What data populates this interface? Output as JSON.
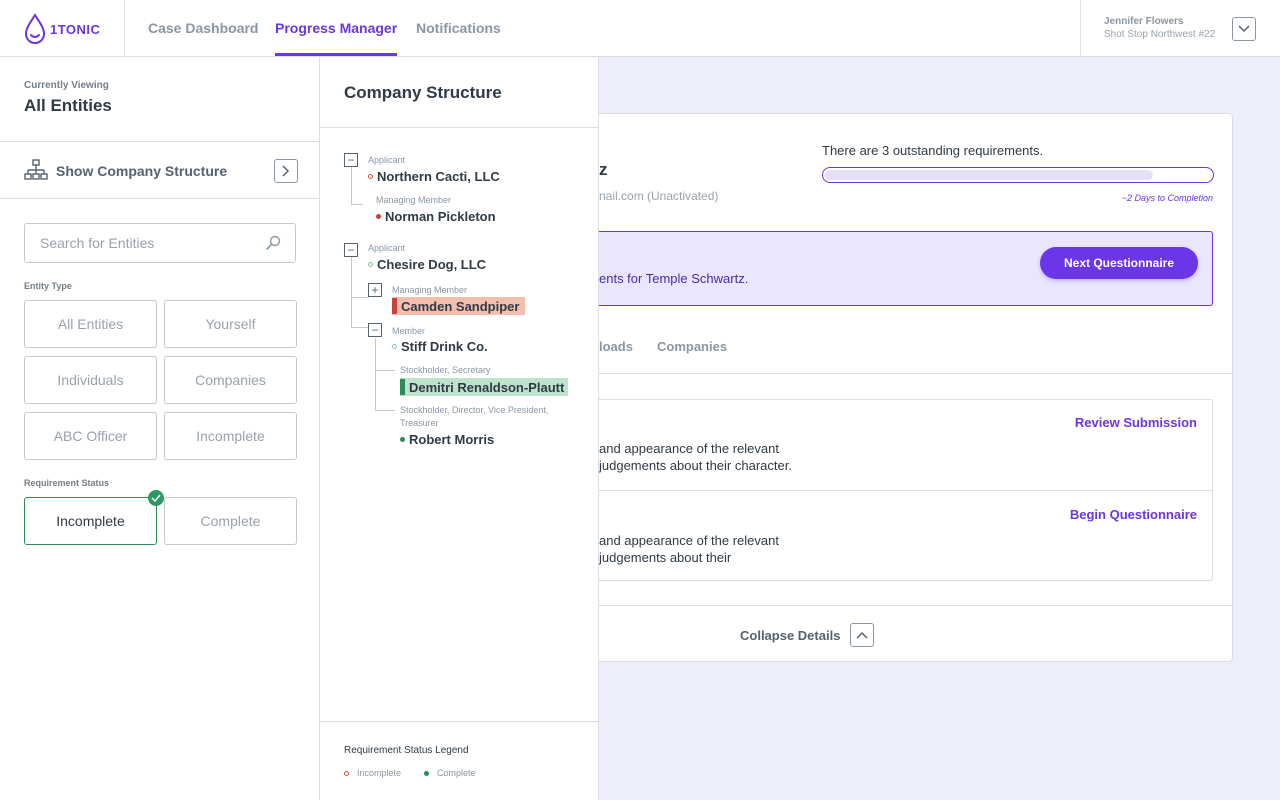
{
  "app": {
    "logo_text": "1TONIC"
  },
  "nav": {
    "tabs": [
      {
        "label": "Case Dashboard"
      },
      {
        "label": "Progress Manager"
      },
      {
        "label": "Notifications"
      }
    ],
    "active_tab": "Progress Manager"
  },
  "user": {
    "name": "Jennifer Flowers",
    "org": "Shot Stop Northwest #22"
  },
  "sidebar": {
    "currently_viewing_label": "Currently Viewing",
    "currently_viewing_value": "All Entities",
    "show_structure_label": "Show Company Structure",
    "search_placeholder": "Search for Entities",
    "entity_type_label": "Entity Type",
    "entity_types": [
      "All Entities",
      "Yourself",
      "Individuals",
      "Companies",
      "ABC Officer",
      "Incomplete"
    ],
    "requirement_status_label": "Requirement Status",
    "requirement_statuses": [
      "Incomplete",
      "Complete"
    ],
    "selected_status": "Incomplete"
  },
  "structure": {
    "title": "Company Structure",
    "nodes": [
      {
        "role": "Applicant",
        "name": "Northern Cacti, LLC"
      },
      {
        "role": "Managing Member",
        "name": "Norman Pickleton"
      },
      {
        "role": "Applicant",
        "name": "Chesire Dog, LLC"
      },
      {
        "role": "Managing Member",
        "name": "Camden Sandpiper"
      },
      {
        "role": "Member",
        "name": "Stiff Drink Co."
      },
      {
        "role": "Stockholder, Secretary",
        "name": "Demitri Renaldson-Plautt"
      },
      {
        "role": "Stockholder, Director, Vice President,",
        "role2": "Treasurer",
        "name": "Robert Morris"
      }
    ],
    "legend_title": "Requirement Status Legend",
    "legend_incomplete": "Incomplete",
    "legend_complete": "Complete"
  },
  "main": {
    "title_fragment": "z",
    "email_fragment": "nail.com (Unactivated)",
    "outstanding": "There are 3 outstanding requirements.",
    "progress_fraction": 0.85,
    "days": "~2 Days to Completion",
    "banner_text": "ents for Temple Schwartz.",
    "next_button": "Next Questionnaire",
    "tabs": [
      "loads",
      "Companies"
    ],
    "requirements": [
      {
        "action": "Review Submission",
        "line1": "and appearance of the relevant",
        "line2": "judgements about their character."
      },
      {
        "action": "Begin Questionnaire",
        "line1": "and appearance of the relevant",
        "line2": "judgements about their"
      }
    ],
    "collapse_label": "Collapse Details"
  },
  "colors": {
    "accent": "#6b35e8",
    "complete": "#2d8a5a",
    "incomplete": "#c8413a"
  }
}
